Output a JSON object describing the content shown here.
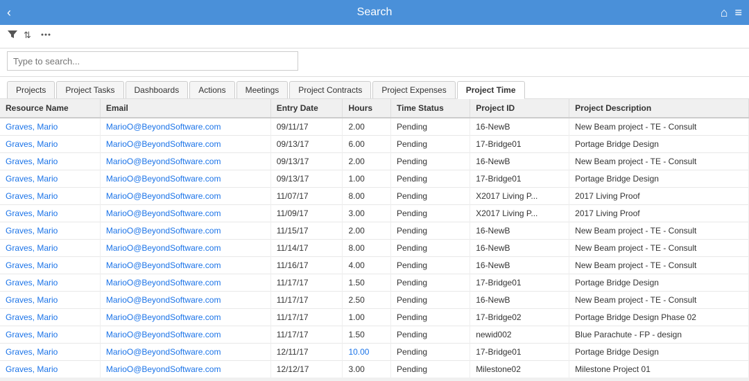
{
  "header": {
    "title": "Search",
    "back_icon": "‹",
    "home_icon": "⌂",
    "menu_icon": "≡"
  },
  "toolbar": {
    "filter_icon": "filter",
    "sort_icon": "sort",
    "more_icon": "more"
  },
  "search": {
    "placeholder": "Type to search...",
    "value": ""
  },
  "tabs": [
    {
      "id": "projects",
      "label": "Projects",
      "active": false
    },
    {
      "id": "project-tasks",
      "label": "Project Tasks",
      "active": false
    },
    {
      "id": "dashboards",
      "label": "Dashboards",
      "active": false
    },
    {
      "id": "actions",
      "label": "Actions",
      "active": false
    },
    {
      "id": "meetings",
      "label": "Meetings",
      "active": false
    },
    {
      "id": "project-contracts",
      "label": "Project Contracts",
      "active": false
    },
    {
      "id": "project-expenses",
      "label": "Project Expenses",
      "active": false
    },
    {
      "id": "project-time",
      "label": "Project Time",
      "active": true
    }
  ],
  "table": {
    "columns": [
      "Resource Name",
      "Email",
      "Entry Date",
      "Hours",
      "Time Status",
      "Project ID",
      "Project Description"
    ],
    "rows": [
      {
        "resource": "Graves, Mario",
        "email": "MarioO@BeyondSoftware.com",
        "entry_date": "09/11/17",
        "hours": "2.00",
        "status": "Pending",
        "project_id": "16-NewB",
        "description": "New Beam project - TE - Consult",
        "highlight": false
      },
      {
        "resource": "Graves, Mario",
        "email": "MarioO@BeyondSoftware.com",
        "entry_date": "09/13/17",
        "hours": "6.00",
        "status": "Pending",
        "project_id": "17-Bridge01",
        "description": "Portage Bridge Design",
        "highlight": false
      },
      {
        "resource": "Graves, Mario",
        "email": "MarioO@BeyondSoftware.com",
        "entry_date": "09/13/17",
        "hours": "2.00",
        "status": "Pending",
        "project_id": "16-NewB",
        "description": "New Beam project - TE - Consult",
        "highlight": false
      },
      {
        "resource": "Graves, Mario",
        "email": "MarioO@BeyondSoftware.com",
        "entry_date": "09/13/17",
        "hours": "1.00",
        "status": "Pending",
        "project_id": "17-Bridge01",
        "description": "Portage Bridge Design",
        "highlight": false
      },
      {
        "resource": "Graves, Mario",
        "email": "MarioO@BeyondSoftware.com",
        "entry_date": "11/07/17",
        "hours": "8.00",
        "status": "Pending",
        "project_id": "X2017 Living P...",
        "description": "2017 Living Proof",
        "highlight": false
      },
      {
        "resource": "Graves, Mario",
        "email": "MarioO@BeyondSoftware.com",
        "entry_date": "11/09/17",
        "hours": "3.00",
        "status": "Pending",
        "project_id": "X2017 Living P...",
        "description": "2017 Living Proof",
        "highlight": false
      },
      {
        "resource": "Graves, Mario",
        "email": "MarioO@BeyondSoftware.com",
        "entry_date": "11/15/17",
        "hours": "2.00",
        "status": "Pending",
        "project_id": "16-NewB",
        "description": "New Beam project - TE - Consult",
        "highlight": false
      },
      {
        "resource": "Graves, Mario",
        "email": "MarioO@BeyondSoftware.com",
        "entry_date": "11/14/17",
        "hours": "8.00",
        "status": "Pending",
        "project_id": "16-NewB",
        "description": "New Beam project - TE - Consult",
        "highlight": false
      },
      {
        "resource": "Graves, Mario",
        "email": "MarioO@BeyondSoftware.com",
        "entry_date": "11/16/17",
        "hours": "4.00",
        "status": "Pending",
        "project_id": "16-NewB",
        "description": "New Beam project - TE - Consult",
        "highlight": false
      },
      {
        "resource": "Graves, Mario",
        "email": "MarioO@BeyondSoftware.com",
        "entry_date": "11/17/17",
        "hours": "1.50",
        "status": "Pending",
        "project_id": "17-Bridge01",
        "description": "Portage Bridge Design",
        "highlight": false
      },
      {
        "resource": "Graves, Mario",
        "email": "MarioO@BeyondSoftware.com",
        "entry_date": "11/17/17",
        "hours": "2.50",
        "status": "Pending",
        "project_id": "16-NewB",
        "description": "New Beam project - TE - Consult",
        "highlight": false
      },
      {
        "resource": "Graves, Mario",
        "email": "MarioO@BeyondSoftware.com",
        "entry_date": "11/17/17",
        "hours": "1.00",
        "status": "Pending",
        "project_id": "17-Bridge02",
        "description": "Portage Bridge Design Phase 02",
        "highlight": false
      },
      {
        "resource": "Graves, Mario",
        "email": "MarioO@BeyondSoftware.com",
        "entry_date": "11/17/17",
        "hours": "1.50",
        "status": "Pending",
        "project_id": "newid002",
        "description": "Blue Parachute - FP - design",
        "highlight": false
      },
      {
        "resource": "Graves, Mario",
        "email": "MarioO@BeyondSoftware.com",
        "entry_date": "12/11/17",
        "hours": "10.00",
        "status": "Pending",
        "project_id": "17-Bridge01",
        "description": "Portage Bridge Design",
        "highlight": true
      },
      {
        "resource": "Graves, Mario",
        "email": "MarioO@BeyondSoftware.com",
        "entry_date": "12/12/17",
        "hours": "3.00",
        "status": "Pending",
        "project_id": "Milestone02",
        "description": "Milestone Project 01",
        "highlight": false
      }
    ]
  }
}
